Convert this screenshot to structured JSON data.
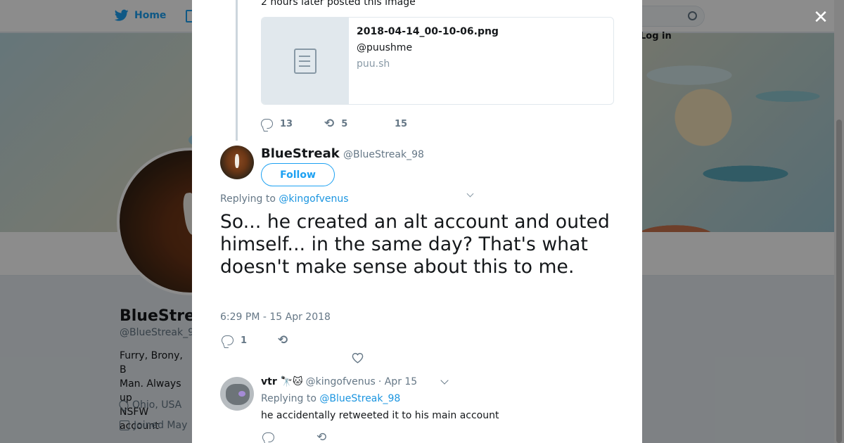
{
  "background_page": {
    "nav": {
      "home_label": "Home",
      "login_label": "Log in"
    },
    "profile": {
      "name": "BlueStreak",
      "handle": "@BlueStreak_9",
      "bio_lines": [
        "Furry, Brony, B",
        "Man. Always up",
        "NSFW account"
      ],
      "location": "Ohio, USA",
      "joined": "Joined May"
    }
  },
  "modal": {
    "close_label": "✕",
    "previous_tweet": {
      "text_fragment": "2 hours later posted this image",
      "card": {
        "title": "2018-04-14_00-10-06.png",
        "description": "@puushme",
        "domain": "puu.sh"
      },
      "reply_count": "13",
      "retweet_count": "5",
      "like_count": "15"
    },
    "main_tweet": {
      "name": "BlueStreak",
      "handle": "@BlueStreak_98",
      "follow_label": "Follow",
      "replying_prefix": "Replying to",
      "replying_to": "@kingofvenus",
      "text": "So... he created an alt account and outed himself... in the same day? That's what doesn't make sense about this to me.",
      "timestamp": "6:29 PM - 15 Apr 2018",
      "reply_count": "1"
    },
    "reply": {
      "name": "vtr 🔭🐱",
      "handle": "@kingofvenus",
      "date": "· Apr 15",
      "replying_prefix": "Replying to",
      "replying_to": "@BlueStreak_98",
      "text": "he accidentally retweeted it to his main account"
    }
  },
  "colors": {
    "accent": "#1da1f2",
    "link": "#1b95e0",
    "muted": "#657786",
    "text": "#14171a"
  }
}
